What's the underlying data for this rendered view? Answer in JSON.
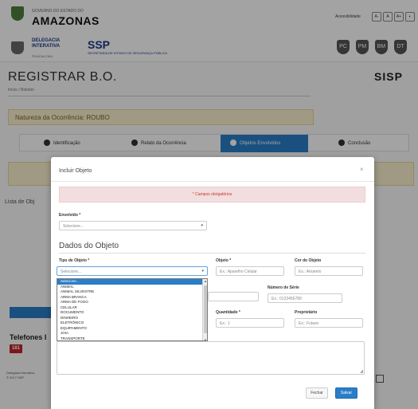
{
  "header": {
    "gov_top": "GOVERNO DO ESTADO DO",
    "gov_name": "AMAZONAS",
    "delegacia": "DELEGACIA INTERATIVA",
    "delegacia_sub": "POLÍCIA CIVIL",
    "ssp": "SSP",
    "ssp_sub": "SECRETARIA DE ESTADO DE SEGURANÇA PÚBLICA",
    "accessibility_label": "Acessibilidade",
    "acc_buttons": [
      "A-",
      "A",
      "A+",
      "◐"
    ],
    "badges": [
      "PC",
      "PM",
      "BM",
      "DT"
    ]
  },
  "page": {
    "title": "REGISTRAR B.O.",
    "breadcrumb": "Início / Boletim",
    "brand": "SISP"
  },
  "nature": "Natureza da Ocorrência: ROUBO",
  "steps": [
    {
      "label": "Identificação"
    },
    {
      "label": "Relato da Ocorrência"
    },
    {
      "label": "Objetos Envolvidos"
    },
    {
      "label": "Conclusão"
    }
  ],
  "background": {
    "list_label": "Lista de Obj",
    "phones": "Telefones I",
    "phone_btn": "181",
    "footer_1": "Delegacia Interativa",
    "footer_2": "© 2017 SSP"
  },
  "modal": {
    "title": "Incluir Objeto",
    "close": "×",
    "alert": "* Campos obrigatórios",
    "involved_label": "Envolvido *",
    "involved_placeholder": "Selecione...",
    "section_title": "Dados do Objeto",
    "type_label": "Tipo de Objeto *",
    "type_placeholder": "Selecione...",
    "object_label": "Objeto *",
    "object_placeholder": "Ex.: Aparelho Celular",
    "color_label": "Cor do Objeto",
    "color_placeholder": "Ex.: Amarelo",
    "serial_label": "Número de Série",
    "serial_placeholder": "Ex.: 0123456789",
    "quantity_label": "Quantidade *",
    "quantity_placeholder": "Ex.: 1",
    "owner_label": "Proprietário",
    "owner_placeholder": "Ex.: Fulano",
    "type_options": [
      "Selecione...",
      "ANIMAL",
      "ANIMAL SILVESTRE",
      "ARMA BRANCA",
      "ARMA DE FOGO",
      "CELULAR",
      "DOCUMENTO",
      "DINHEIRO",
      "ELETRÔNICO",
      "EQUIPAMENTO",
      "JOIA",
      "TRANSPORTE"
    ],
    "cancel_button": "Fechar",
    "save_button": "Salvar"
  },
  "colors": {
    "accent": "#2a7ec8",
    "danger": "#c0392b",
    "warning_bg": "#fbf1cf"
  }
}
